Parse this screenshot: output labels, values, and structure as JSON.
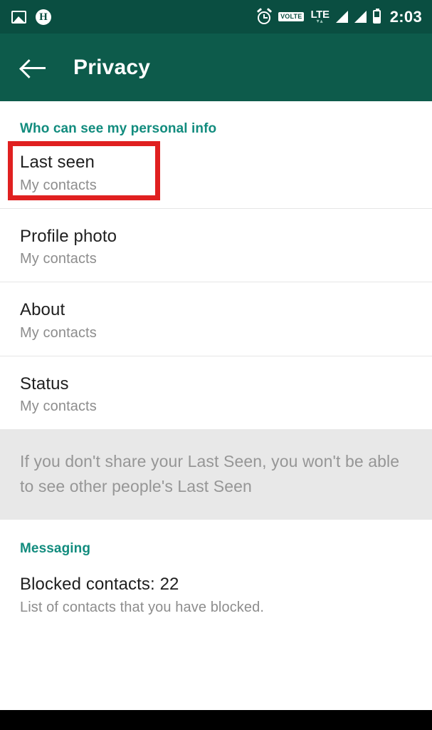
{
  "status_bar": {
    "icons": [
      "photo-icon",
      "h-circle-icon",
      "alarm-icon"
    ],
    "volte_label": "VOLTE",
    "network_label": "LTE",
    "network_arrows": "▾▴",
    "time": "2:03"
  },
  "app_bar": {
    "back_label": "back-arrow",
    "title": "Privacy"
  },
  "sections": [
    {
      "header": "Who can see my personal info",
      "rows": [
        {
          "title": "Last seen",
          "subtitle": "My contacts",
          "highlighted": true
        },
        {
          "title": "Profile photo",
          "subtitle": "My contacts",
          "highlighted": false
        },
        {
          "title": "About",
          "subtitle": "My contacts",
          "highlighted": false
        },
        {
          "title": "Status",
          "subtitle": "My contacts",
          "highlighted": false
        }
      ],
      "info_text": "If you don't share your Last Seen, you won't be able to see other people's Last Seen"
    },
    {
      "header": "Messaging",
      "rows": [
        {
          "title": "Blocked contacts: 22",
          "subtitle": "List of contacts that you have blocked.",
          "highlighted": false
        }
      ]
    }
  ],
  "colors": {
    "status_bar": "#0a4e41",
    "app_bar": "#0d5b4b",
    "accent_teal": "#128c7e",
    "highlight_red": "#e02020",
    "info_block_bg": "#e8e8e8",
    "title_text": "#1f1f1f",
    "subtitle_text": "#8d8d8d"
  }
}
